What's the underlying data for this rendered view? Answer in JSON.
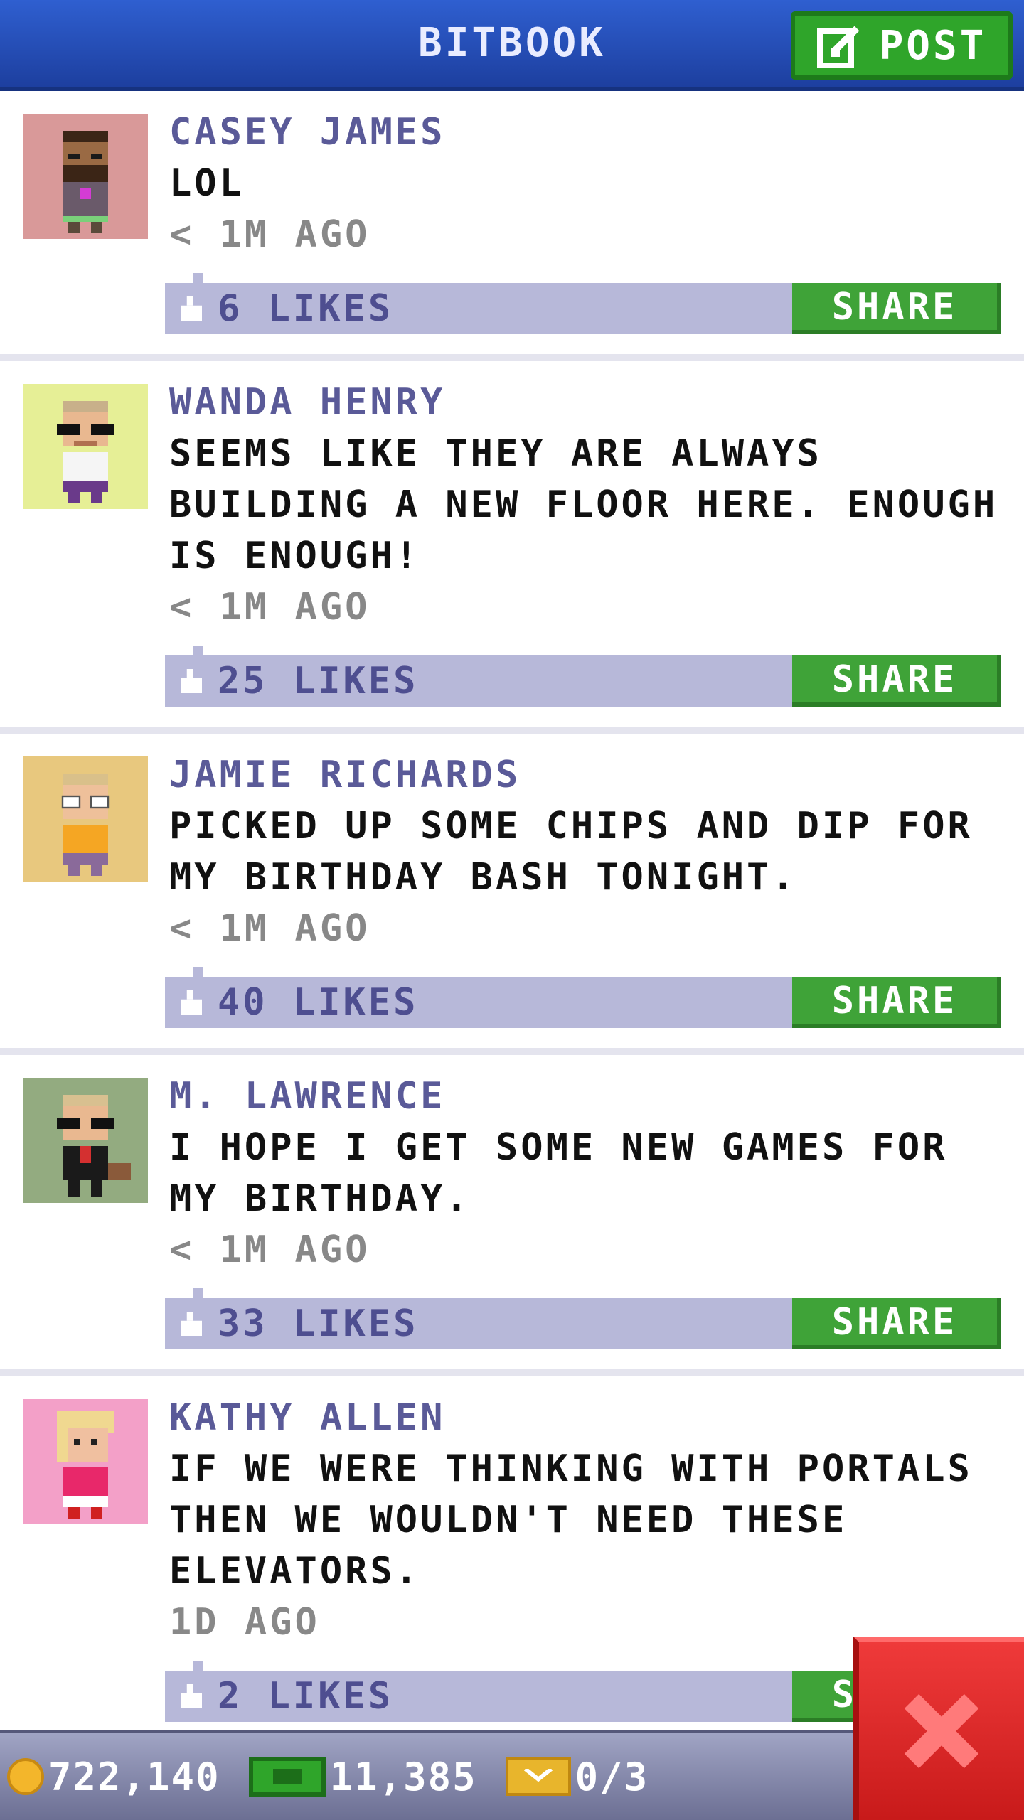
{
  "header": {
    "title": "BITBOOK",
    "post_label": "POST"
  },
  "colors": {
    "header_blue": "#2448b8",
    "author_purple": "#5a5a98",
    "likes_bar": "#b7b8d9",
    "share_green": "#3fa338",
    "close_red": "#e02a2a"
  },
  "posts": [
    {
      "author": "CASEY JAMES",
      "text": "LOL",
      "time": "< 1M AGO",
      "likes": "6 LIKES",
      "share": "SHARE",
      "avatar_bg": "#d99999",
      "avatar_icon": "bearded-man-avatar-icon"
    },
    {
      "author": "WANDA HENRY",
      "text": "SEEMS LIKE THEY ARE ALWAYS BUILDING A NEW FLOOR HERE. ENOUGH IS ENOUGH!",
      "time": "< 1M AGO",
      "likes": "25 LIKES",
      "share": "SHARE",
      "avatar_bg": "#e6ef96",
      "avatar_icon": "sunglasses-woman-avatar-icon"
    },
    {
      "author": "JAMIE RICHARDS",
      "text": "PICKED UP SOME CHIPS AND DIP FOR MY BIRTHDAY BASH TONIGHT.",
      "time": "< 1M AGO",
      "likes": "40 LIKES",
      "share": "SHARE",
      "avatar_bg": "#e8c87e",
      "avatar_icon": "glasses-person-avatar-icon"
    },
    {
      "author": "M. LAWRENCE",
      "text": "I HOPE I GET SOME NEW GAMES FOR MY BIRTHDAY.",
      "time": "< 1M AGO",
      "likes": "33 LIKES",
      "share": "SHARE",
      "avatar_bg": "#93ab80",
      "avatar_icon": "businessman-avatar-icon"
    },
    {
      "author": "KATHY ALLEN",
      "text": "IF WE WERE THINKING WITH PORTALS THEN WE WOULDN'T NEED THESE ELEVATORS.",
      "time": "1D AGO",
      "likes": "2 LIKES",
      "share": "SHARE",
      "avatar_bg": "#f3a0c8",
      "avatar_icon": "blonde-woman-avatar-icon"
    }
  ],
  "footer": {
    "coins": "722,140",
    "bux": "11,385",
    "tickets": "0/3"
  }
}
